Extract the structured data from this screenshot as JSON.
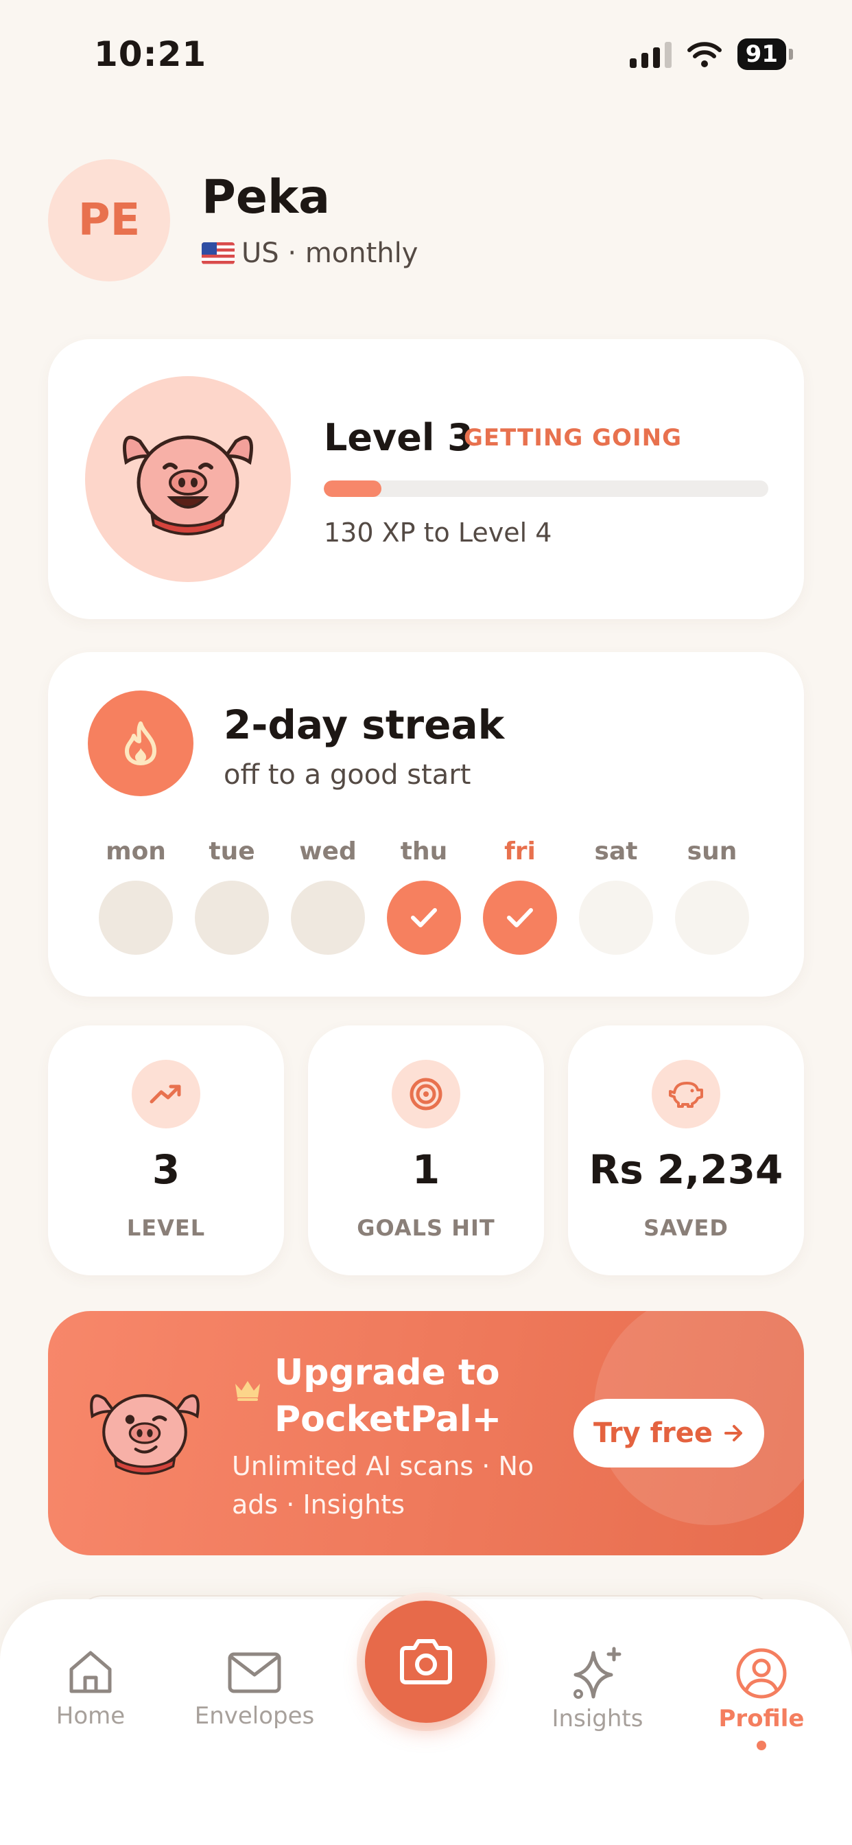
{
  "status_bar": {
    "time": "10:21",
    "battery": "91"
  },
  "profile": {
    "initials": "PE",
    "name": "Peka",
    "region": "US · monthly"
  },
  "level_card": {
    "title": "Level 3",
    "tag": "GETTING GOING",
    "progress_fraction": 0.13,
    "xp_text": "130 XP to Level 4"
  },
  "streak": {
    "title": "2-day streak",
    "subtitle": "off to a good start",
    "days": [
      {
        "label": "mon",
        "state": "missed"
      },
      {
        "label": "tue",
        "state": "missed"
      },
      {
        "label": "wed",
        "state": "missed"
      },
      {
        "label": "thu",
        "state": "done"
      },
      {
        "label": "fri",
        "state": "done"
      },
      {
        "label": "sat",
        "state": "future"
      },
      {
        "label": "sun",
        "state": "future"
      }
    ]
  },
  "stats": [
    {
      "icon": "trending-up-icon",
      "value": "3",
      "label": "LEVEL"
    },
    {
      "icon": "target-icon",
      "value": "1",
      "label": "GOALS HIT"
    },
    {
      "icon": "piggy-bank-icon",
      "value": "Rs 2,234",
      "label": "SAVED"
    }
  ],
  "upgrade": {
    "title": "Upgrade to PocketPal+",
    "subtitle": "Unlimited AI scans · No ads · Insights",
    "button_label": "Try free"
  },
  "tabs": [
    {
      "label": "Home",
      "icon": "home-icon",
      "active": false
    },
    {
      "label": "Envelopes",
      "icon": "envelope-icon",
      "active": false
    },
    {
      "label": "",
      "icon": "camera-icon",
      "active": false
    },
    {
      "label": "Insights",
      "icon": "sparkles-icon",
      "active": false
    },
    {
      "label": "Profile",
      "icon": "user-circle-icon",
      "active": true
    }
  ],
  "colors": {
    "accent": "#f47e5f",
    "background": "#faf6f1",
    "card": "#ffffff"
  }
}
